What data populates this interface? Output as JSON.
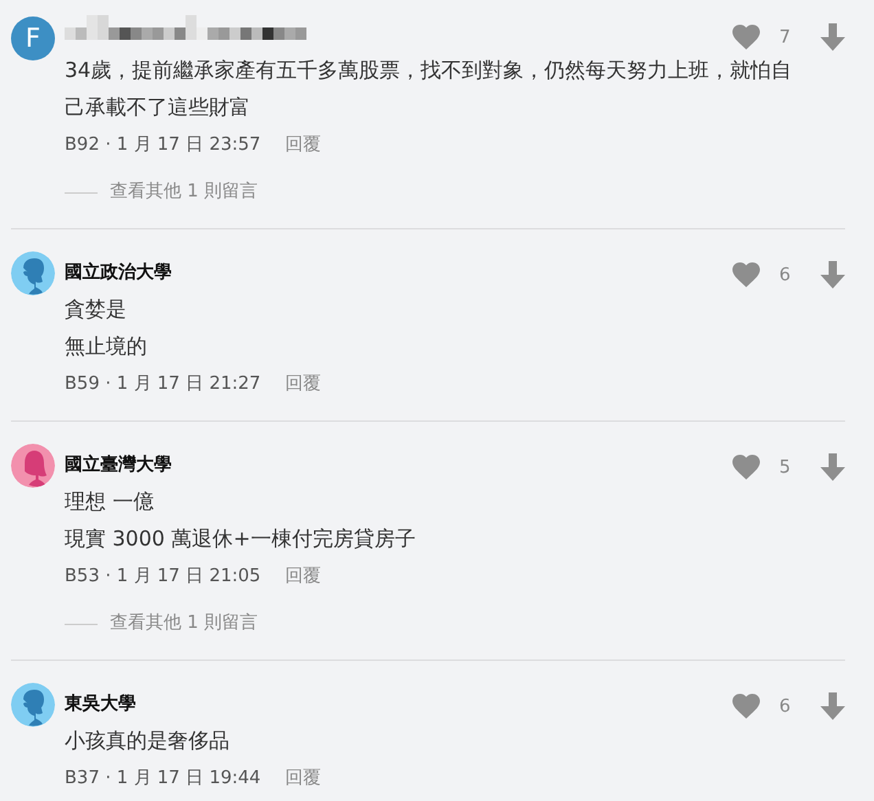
{
  "comments": [
    {
      "avatar": {
        "kind": "letter",
        "letter": "F"
      },
      "name_hidden": true,
      "lines": [
        "34歲，提前繼承家產有五千多萬股票，找不到對象，仍然每天努力上班，就怕自己承載不了這些財富"
      ],
      "likes": "7",
      "meta": "B92 · 1 月 17 日 23:57",
      "reply": "回覆",
      "more_replies": "查看其他 1 則留言"
    },
    {
      "avatar": {
        "kind": "male"
      },
      "name": "國立政治大學",
      "lines": [
        "貪婪是",
        "無止境的"
      ],
      "likes": "6",
      "meta": "B59 · 1 月 17 日 21:27",
      "reply": "回覆"
    },
    {
      "avatar": {
        "kind": "female"
      },
      "name": "國立臺灣大學",
      "lines": [
        "理想 一億",
        "現實 3000 萬退休+一棟付完房貸房子"
      ],
      "likes": "5",
      "meta": "B53 · 1 月 17 日 21:05",
      "reply": "回覆",
      "more_replies": "查看其他 1 則留言"
    },
    {
      "avatar": {
        "kind": "male"
      },
      "name": "東吳大學",
      "lines": [
        "小孩真的是奢侈品"
      ],
      "likes": "6",
      "meta": "B37 · 1 月 17 日 19:44",
      "reply": "回覆"
    }
  ]
}
